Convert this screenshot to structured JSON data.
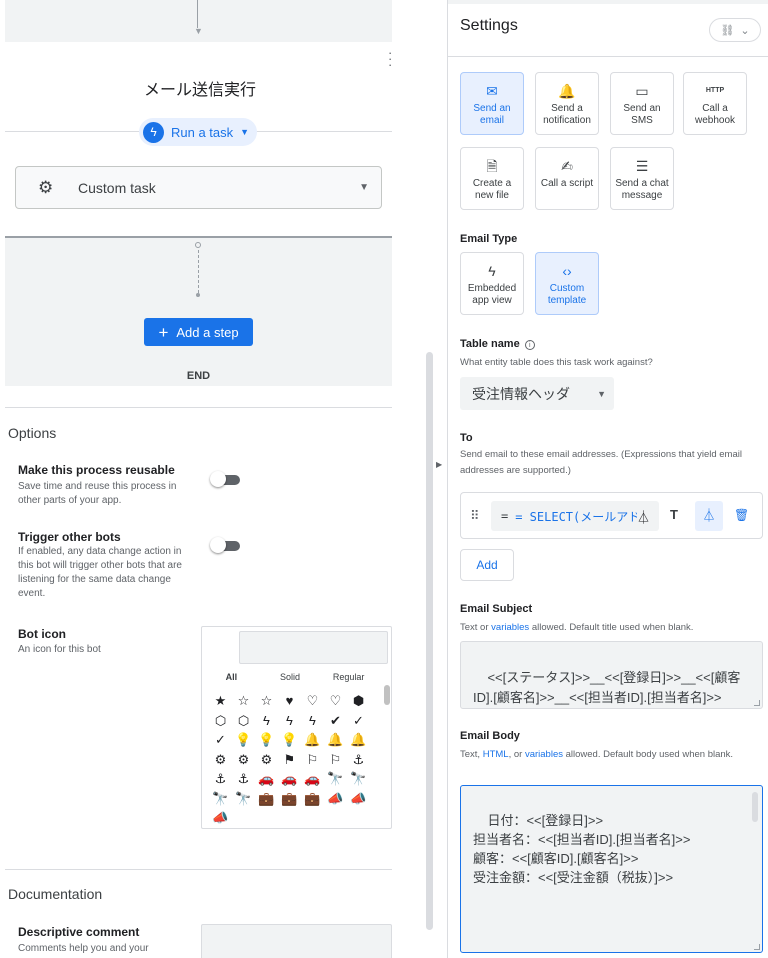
{
  "flow": {
    "step_title": "メール送信実行",
    "run_task_label": "Run a task",
    "task_select_value": "Custom task",
    "add_step_label": "Add a step",
    "end_label": "END"
  },
  "options": {
    "heading": "Options",
    "reusable_title": "Make this process reusable",
    "reusable_desc": "Save time and reuse this process in other parts of your app.",
    "reusable_on": false,
    "trigger_title": "Trigger other bots",
    "trigger_desc": "If enabled, any data change action in this bot will trigger other bots that are listening for the same data change event.",
    "trigger_on": false,
    "bot_icon_title": "Bot icon",
    "bot_icon_desc": "An icon for this bot",
    "icon_tabs": [
      "All",
      "Solid",
      "Regular"
    ],
    "icons": [
      "★",
      "☆",
      "☆",
      "♥",
      "♡",
      "♡",
      "⬢",
      "⬡",
      "⬡",
      "ϟ",
      "ϟ",
      "ϟ",
      "✔",
      "✓",
      "✓",
      "💡",
      "💡",
      "💡",
      "🔔",
      "🔔",
      "🔔",
      "⚙",
      "⚙",
      "⚙",
      "⚑",
      "⚐",
      "⚐",
      "⚓",
      "⚓",
      "⚓",
      "🚗",
      "🚗",
      "🚗",
      "🔭",
      "🔭",
      "🔭",
      "🔭",
      "💼",
      "💼",
      "💼",
      "📣",
      "📣",
      "📣"
    ]
  },
  "documentation": {
    "heading": "Documentation",
    "comment_title": "Descriptive comment",
    "comment_desc": "Comments help you and your"
  },
  "settings": {
    "title": "Settings",
    "link_chip_icon": "link-off-icon",
    "tiles": [
      {
        "icon": "mail-icon",
        "glyph": "✉",
        "label": "Send an email",
        "selected": true
      },
      {
        "icon": "bell-icon",
        "glyph": "🔔",
        "label": "Send a notification",
        "selected": false
      },
      {
        "icon": "sms-icon",
        "glyph": "▭",
        "label": "Send an SMS",
        "selected": false
      },
      {
        "icon": "http-icon",
        "glyph": "HTTP",
        "label": "Call a webhook",
        "selected": false
      },
      {
        "icon": "new-file-icon",
        "glyph": "🗎",
        "label": "Create a new file",
        "selected": false
      },
      {
        "icon": "script-icon",
        "glyph": "✍",
        "label": "Call a script",
        "selected": false
      },
      {
        "icon": "chat-icon",
        "glyph": "☰",
        "label": "Send a chat message",
        "selected": false
      }
    ],
    "email_type_label": "Email Type",
    "email_types": [
      {
        "icon": "bolt-icon",
        "glyph": "ϟ",
        "label": "Embedded app view",
        "selected": false
      },
      {
        "icon": "code-icon",
        "glyph": "‹›",
        "label": "Custom template",
        "selected": true
      }
    ],
    "table_name_label": "Table name",
    "table_name_help": "What entity table does this task work against?",
    "table_name_value": "受注情報ヘッダ",
    "to_label": "To",
    "to_help": "Send email to these email addresses. (Expressions that yield email addresses are supported.)",
    "to_expression": "= SELECT(メールアド",
    "add_label": "Add",
    "subject_label": "Email Subject",
    "subject_help_pre": "Text or ",
    "subject_help_link": "variables",
    "subject_help_post": " allowed. Default title used when blank.",
    "subject_value": "<<[ステータス]>>__<<[登録日]>>__<<[顧客ID].[顧客名]>>__<<[担当者ID].[担当者名]>>",
    "body_label": "Email Body",
    "body_help_pre": "Text, ",
    "body_help_link1": "HTML",
    "body_help_mid": ", or ",
    "body_help_link2": "variables",
    "body_help_post": " allowed. Default body used when blank.",
    "body_value": "日付：<<[登録日]>>\n担当者名：<<[担当者ID].[担当者名]>>\n顧客：<<[顧客ID].[顧客名]>>\n受注金額：<<[受注金額（税抜）]>>"
  },
  "colors": {
    "accent": "#1a73e8",
    "selected_tile_bg": "#e8f0fe",
    "panel_gray": "#f1f3f4"
  }
}
